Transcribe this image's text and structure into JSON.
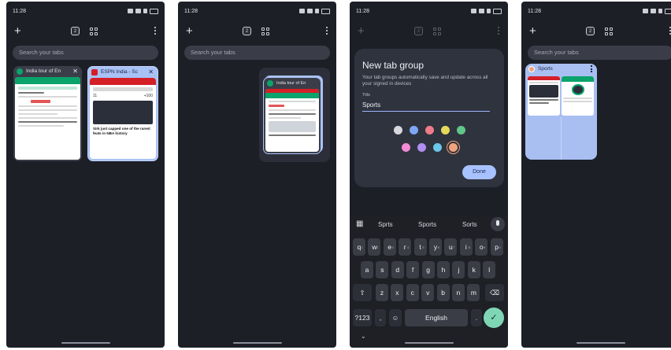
{
  "panels": [
    {
      "status_time": "11:28",
      "search_placeholder": "Search your tabs",
      "tab_count": "2",
      "cards": [
        {
          "title": "India tour of En",
          "close": "✕"
        },
        {
          "title": "ESPN India - Sc",
          "close": "✕"
        }
      ],
      "thumb_texts": {
        "espn_headline": "Sirk just capped one of the rarest feats in NBA history",
        "score_a": "11",
        "score_b": "+100"
      }
    },
    {
      "status_time": "11:28",
      "search_placeholder": "Search your tabs",
      "tab_count": "2",
      "drag_card_title": "India tour of En"
    },
    {
      "status_time": "11:28",
      "tab_count": "2",
      "dialog": {
        "title": "New tab group",
        "description": "Your tab groups automatically save and update across all your signed in devices",
        "field_label": "Title",
        "field_value": "Sports",
        "done_label": "Done",
        "colors": [
          "#d8d8dc",
          "#7ea6f5",
          "#f07c8b",
          "#e6d85a",
          "#61c68a",
          "#f28ad4",
          "#b18ef2",
          "#6cc6e9",
          "#f0a27a"
        ],
        "selected_color_index": 8
      },
      "keyboard": {
        "suggestions": [
          "Sprts",
          "Sports",
          "Sorts"
        ],
        "row1": [
          "q",
          "w",
          "e",
          "r",
          "t",
          "y",
          "u",
          "i",
          "o",
          "p"
        ],
        "row1_sup": [
          "1",
          "2",
          "3",
          "4",
          "5",
          "6",
          "7",
          "8",
          "9",
          "0"
        ],
        "row2": [
          "a",
          "s",
          "d",
          "f",
          "g",
          "h",
          "j",
          "k",
          "l"
        ],
        "row3": [
          "z",
          "x",
          "c",
          "v",
          "b",
          "n",
          "m"
        ],
        "shift": "⇧",
        "backspace": "⌫",
        "symbols": "?123",
        "comma": ",",
        "emoji": "☺",
        "space": "English",
        "period": ".",
        "enter": "✓",
        "grid_icon": "▦",
        "mic_icon": "🎤",
        "hide": "⌄"
      }
    },
    {
      "status_time": "11:28",
      "search_placeholder": "Search your tabs",
      "tab_count": "2",
      "group": {
        "title": "Sports"
      }
    }
  ],
  "icons": {
    "plus": "+",
    "kebab": "more-vert-icon"
  }
}
